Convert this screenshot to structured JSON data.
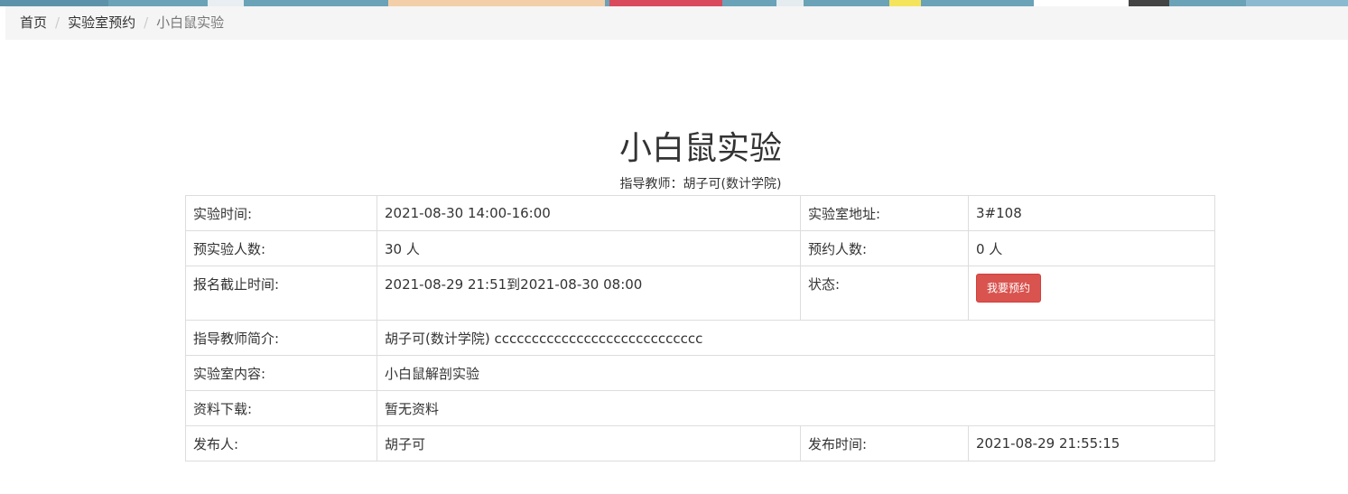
{
  "breadcrumb": {
    "home": "首页",
    "lab_booking": "实验室预约",
    "current": "小白鼠实验",
    "separator": "/"
  },
  "experiment": {
    "title": "小白鼠实验",
    "instructor_line": "指导教师：胡子可(数计学院)"
  },
  "details": {
    "time_label": "实验时间:",
    "time_value": "2021-08-30 14:00-16:00",
    "address_label": "实验室地址:",
    "address_value": "3#108",
    "planned_label": "预实验人数:",
    "planned_value": "30 人",
    "booked_label": "预约人数:",
    "booked_value": "0 人",
    "deadline_label": "报名截止时间:",
    "deadline_value": "2021-08-29 21:51到2021-08-30 08:00",
    "status_label": "状态:",
    "reserve_button": "我要预约",
    "intro_label": "指导教师简介:",
    "intro_value": "胡子可(数计学院)  cccccccccccccccccccccccccccc",
    "content_label": "实验室内容:",
    "content_value": "小白鼠解剖实验",
    "download_label": "资料下载:",
    "download_value": "暂无资料",
    "publisher_label": "发布人:",
    "publisher_value": "胡子可",
    "publish_time_label": "发布时间:",
    "publish_time_value": "2021-08-29 21:55:15"
  },
  "colors": {
    "reserve_button_bg": "#d9534f",
    "breadcrumb_bg": "#f5f5f5",
    "table_border": "#dddddd"
  }
}
